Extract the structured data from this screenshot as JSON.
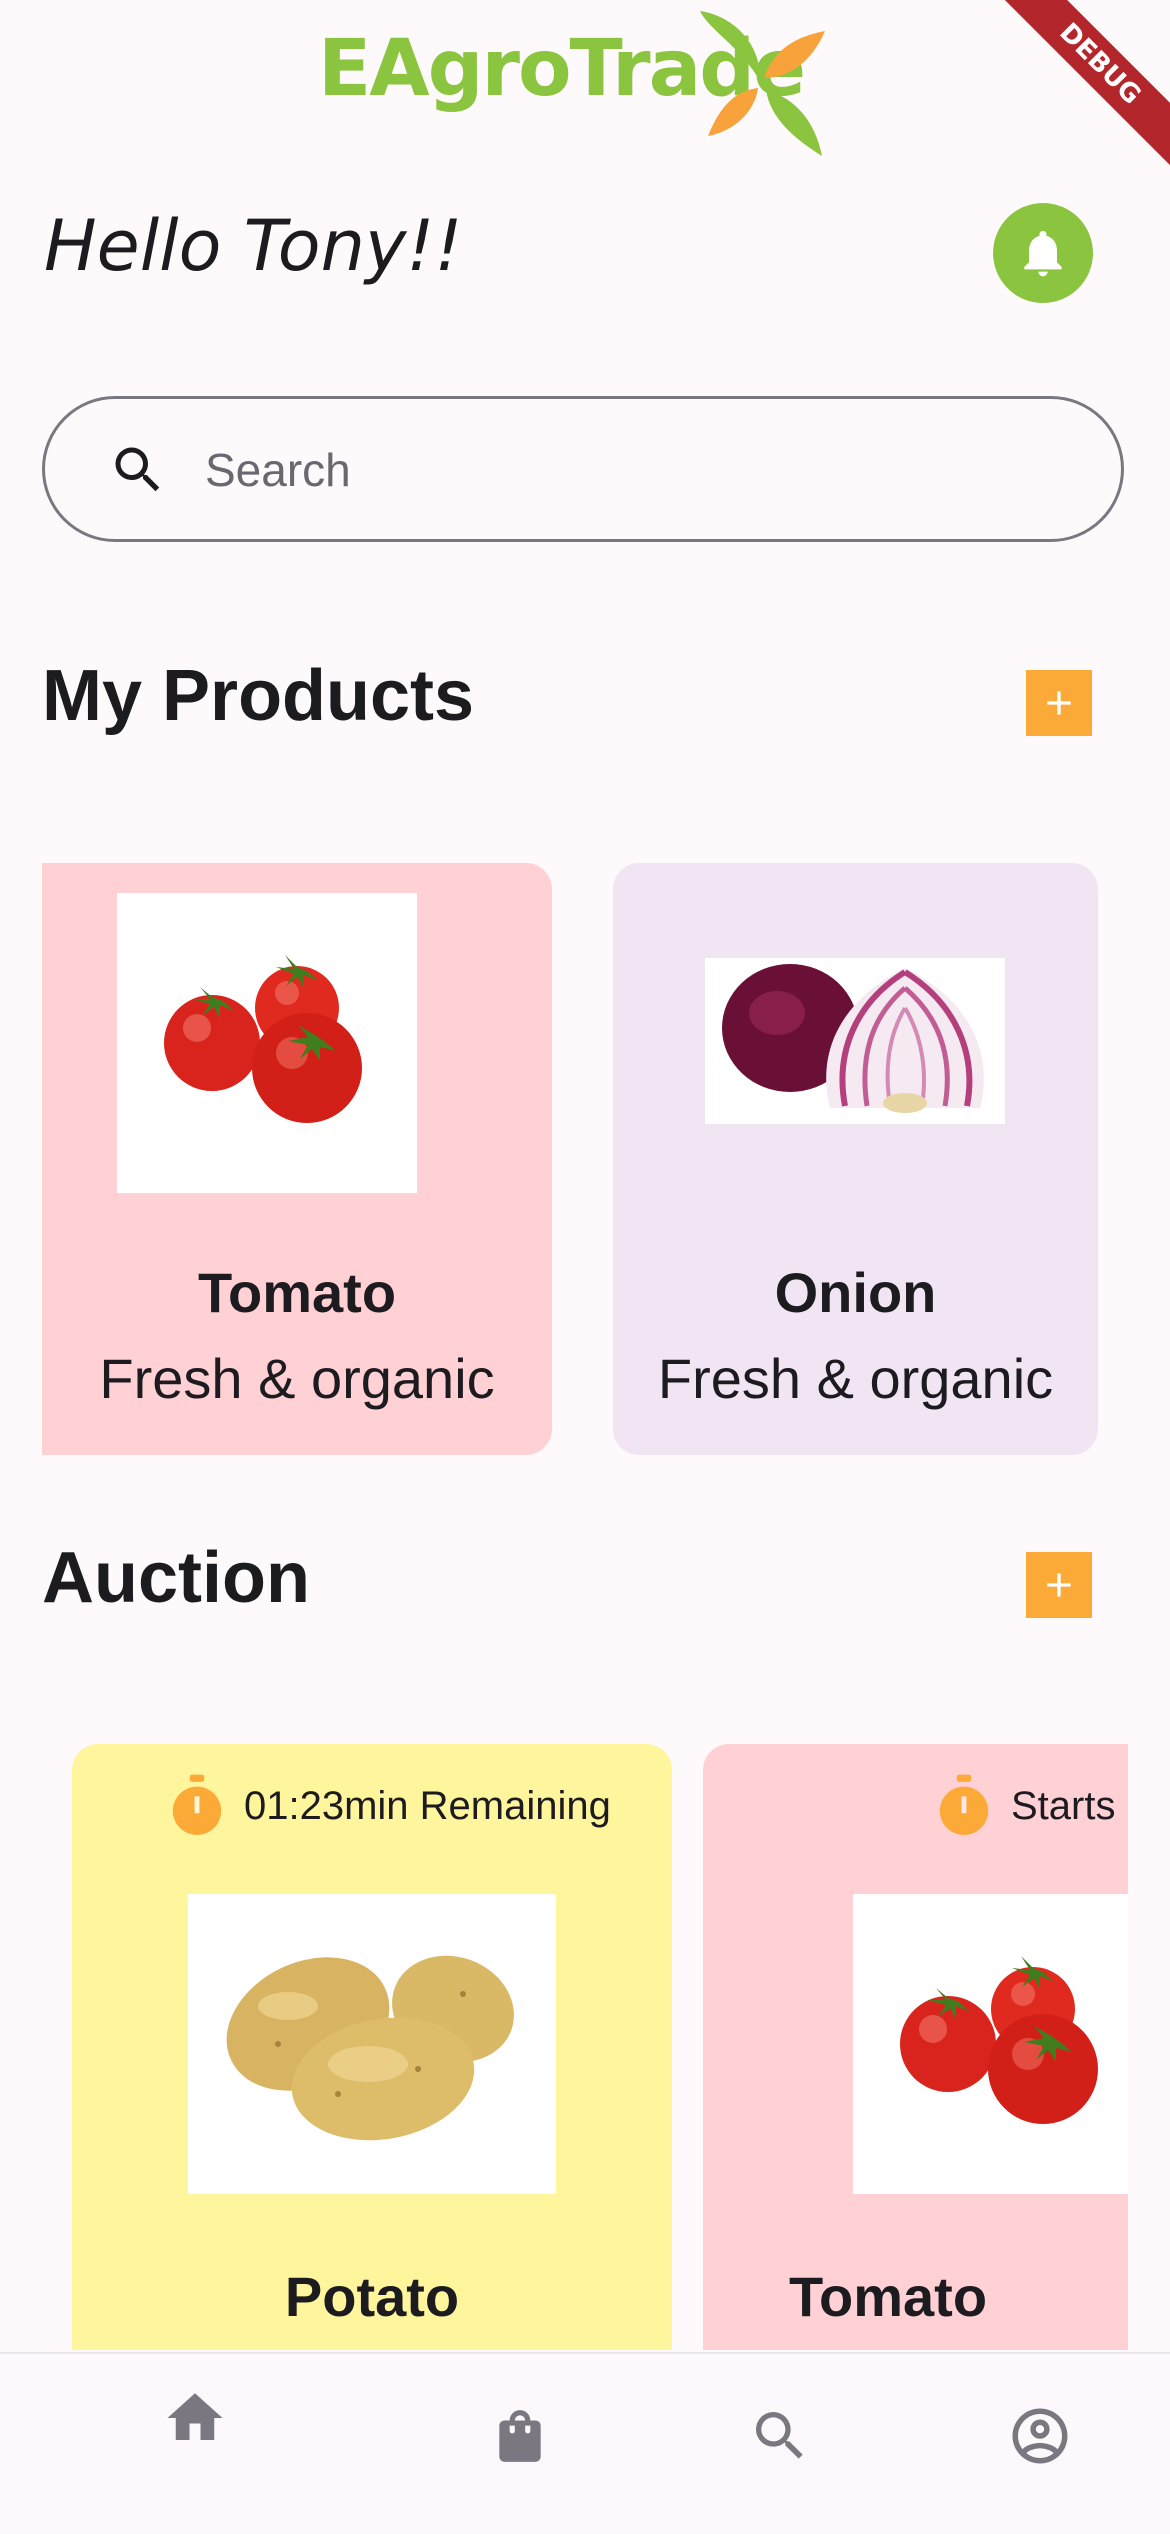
{
  "app": {
    "logo_text": "EAgroTrade",
    "debug_label": "DEBUG"
  },
  "header": {
    "greeting": "Hello Tony!!"
  },
  "search": {
    "placeholder": "Search",
    "value": ""
  },
  "my_products": {
    "title": "My Products",
    "items": [
      {
        "name": "Tomato",
        "description": "Fresh & organic",
        "image": "tomato-image",
        "bg": "#ffd0d4"
      },
      {
        "name": "Onion",
        "description": "Fresh & organic",
        "image": "onion-image",
        "bg": "#f1e5f4"
      }
    ]
  },
  "auction": {
    "title": "Auction",
    "items": [
      {
        "name": "Potato",
        "timer": "01:23min Remaining",
        "image": "potato-image",
        "bg": "#fff59d"
      },
      {
        "name": "Tomato",
        "timer": "Starts",
        "image": "tomato-image",
        "bg": "#ffd0d4"
      }
    ]
  },
  "bottom_nav": {
    "items": [
      {
        "icon": "home-icon",
        "active": true
      },
      {
        "icon": "shopping-bag-icon",
        "active": false
      },
      {
        "icon": "search-icon",
        "active": false
      },
      {
        "icon": "account-circle-icon",
        "active": false
      }
    ]
  },
  "colors": {
    "brand_green": "#8bc53f",
    "brand_orange": "#fbaa38",
    "debug_red": "#b3272c"
  }
}
